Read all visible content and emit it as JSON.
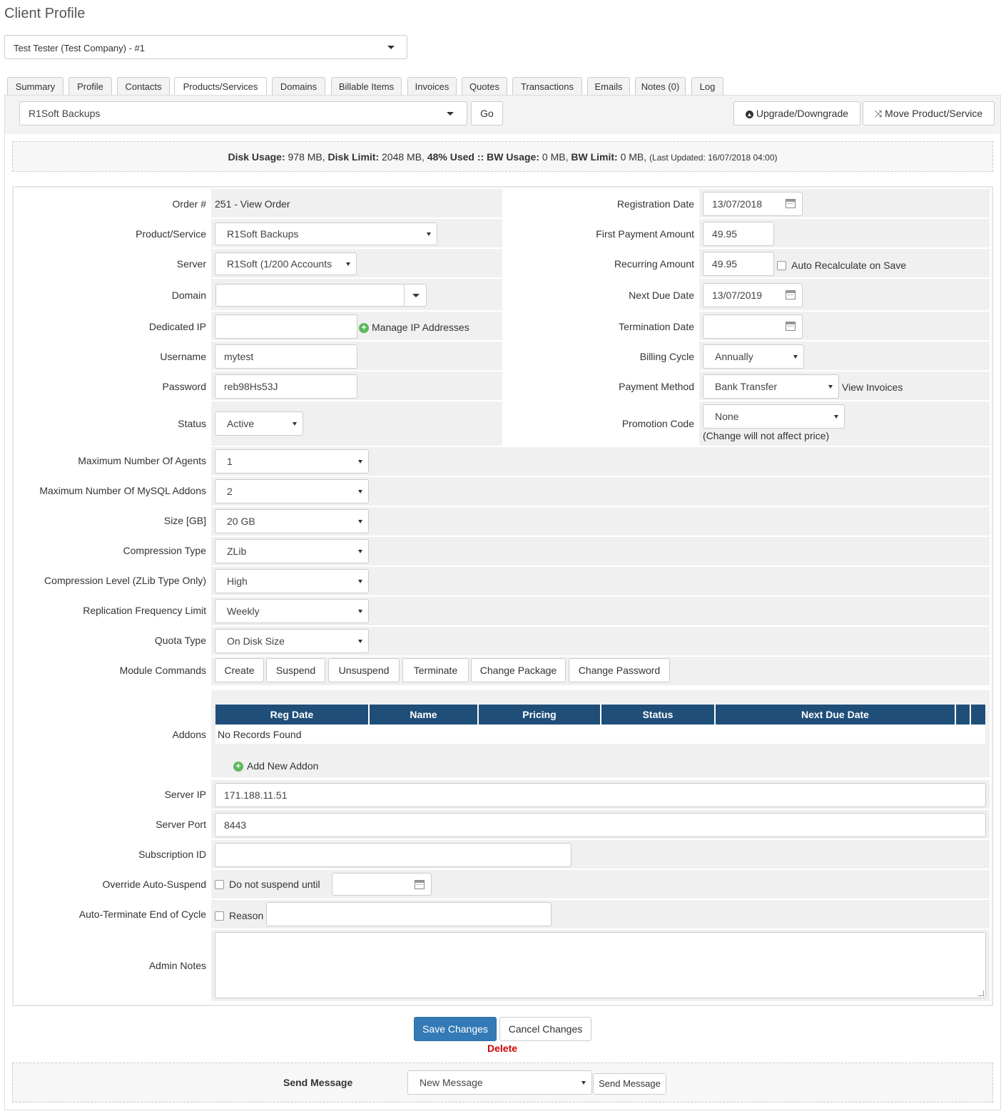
{
  "page_title": "Client Profile",
  "client_select": "Test Tester (Test Company) - #1",
  "tabs": [
    "Summary",
    "Profile",
    "Contacts",
    "Products/Services",
    "Domains",
    "Billable Items",
    "Invoices",
    "Quotes",
    "Transactions",
    "Emails",
    "Notes (0)",
    "Log"
  ],
  "active_tab": "Products/Services",
  "product_select": "R1Soft Backups",
  "go": "Go",
  "upgrade": "Upgrade/Downgrade",
  "move": "Move Product/Service",
  "usage": {
    "disk_usage_label": "Disk Usage:",
    "disk_usage": "978 MB,",
    "disk_limit_label": "Disk Limit:",
    "disk_limit": "2048 MB,",
    "used": "48% Used",
    "sep": "::",
    "bw_usage_label": "BW Usage:",
    "bw_usage": "0 MB,",
    "bw_limit_label": "BW Limit:",
    "bw_limit": "0 MB,",
    "updated": "(Last Updated: 16/07/2018 04:00)"
  },
  "left": {
    "order_label": "Order #",
    "order_value": "251 - View Order",
    "product_label": "Product/Service",
    "product_value": "R1Soft Backups",
    "server_label": "Server",
    "server_value": "R1Soft (1/200 Accounts",
    "domain_label": "Domain",
    "domain_value": "",
    "dedicated_ip_label": "Dedicated IP",
    "dedicated_ip_value": "",
    "manage_ip": "Manage IP Addresses",
    "username_label": "Username",
    "username_value": "mytest",
    "password_label": "Password",
    "password_value": "reb98Hs53J",
    "status_label": "Status",
    "status_value": "Active"
  },
  "right": {
    "reg_date_label": "Registration Date",
    "reg_date": "13/07/2018",
    "first_payment_label": "First Payment Amount",
    "first_payment": "49.95",
    "recurring_label": "Recurring Amount",
    "recurring": "49.95",
    "auto_recalc": "Auto Recalculate on Save",
    "next_due_label": "Next Due Date",
    "next_due": "13/07/2019",
    "termination_label": "Termination Date",
    "termination": "",
    "billing_cycle_label": "Billing Cycle",
    "billing_cycle": "Annually",
    "payment_method_label": "Payment Method",
    "payment_method": "Bank Transfer",
    "view_invoices": "View Invoices",
    "promo_label": "Promotion Code",
    "promo": "None",
    "promo_note": "(Change will not affect price)"
  },
  "options": [
    {
      "label": "Maximum Number Of Agents",
      "value": "1"
    },
    {
      "label": "Maximum Number Of MySQL Addons",
      "value": "2"
    },
    {
      "label": "Size [GB]",
      "value": "20 GB"
    },
    {
      "label": "Compression Type",
      "value": "ZLib"
    },
    {
      "label": "Compression Level (ZLib Type Only)",
      "value": "High"
    },
    {
      "label": "Replication Frequency Limit",
      "value": "Weekly"
    },
    {
      "label": "Quota Type",
      "value": "On Disk Size"
    }
  ],
  "module_label": "Module Commands",
  "module_cmds": [
    "Create",
    "Suspend",
    "Unsuspend",
    "Terminate",
    "Change Package",
    "Change Password"
  ],
  "addons": {
    "label": "Addons",
    "headers": [
      "Reg Date",
      "Name",
      "Pricing",
      "Status",
      "Next Due Date"
    ],
    "empty": "No Records Found",
    "add": "Add New Addon"
  },
  "server_ip_label": "Server IP",
  "server_ip": "171.188.11.51",
  "server_port_label": "Server Port",
  "server_port": "8443",
  "subscription_label": "Subscription ID",
  "subscription": "",
  "override_label": "Override Auto-Suspend",
  "override_text": "Do not suspend until",
  "autoterm_label": "Auto-Terminate End of Cycle",
  "autoterm_text": "Reason",
  "admin_notes_label": "Admin Notes",
  "save": "Save Changes",
  "cancel": "Cancel Changes",
  "delete": "Delete",
  "send_message_label": "Send Message",
  "message_select": "New Message",
  "send_button": "Send Message"
}
